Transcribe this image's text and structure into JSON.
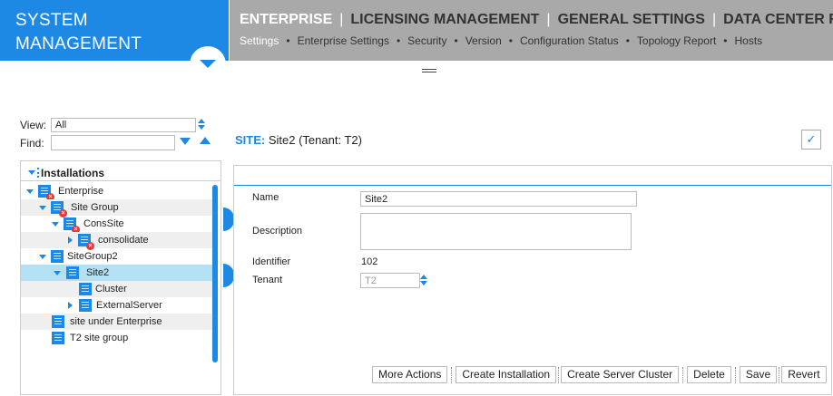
{
  "brand": {
    "line1": "SYSTEM",
    "line2": "MANAGEMENT"
  },
  "top_menu": [
    "ENTERPRISE",
    "LICENSING MANAGEMENT",
    "GENERAL SETTINGS",
    "DATA CENTER RE"
  ],
  "sub_menu": [
    "Settings",
    "Enterprise Settings",
    "Security",
    "Version",
    "Configuration Status",
    "Topology Report",
    "Hosts"
  ],
  "filter": {
    "view_label": "View:",
    "view_value": "All",
    "find_label": "Find:",
    "find_value": ""
  },
  "tree": {
    "header": "Installations",
    "items": [
      {
        "label": "Enterprise"
      },
      {
        "label": "Site Group"
      },
      {
        "label": "ConsSite"
      },
      {
        "label": "consolidate"
      },
      {
        "label": "SiteGroup2"
      },
      {
        "label": "Site2"
      },
      {
        "label": "Cluster"
      },
      {
        "label": "ExternalServer"
      },
      {
        "label": "site under Enterprise"
      },
      {
        "label": "T2 site group"
      }
    ]
  },
  "detail": {
    "kind": "SITE:",
    "title": "Site2 (Tenant: T2)",
    "check": "✓",
    "name_label": "Name",
    "name_value": "Site2",
    "description_label": "Description",
    "description_value": "",
    "identifier_label": "Identifier",
    "identifier_value": "102",
    "tenant_label": "Tenant",
    "tenant_value": "T2"
  },
  "buttons": [
    "More Actions",
    "Create Installation",
    "Create Server Cluster",
    "Delete",
    "Save",
    "Revert"
  ],
  "colors": {
    "accent": "#1e88e5",
    "header_gray": "#a9a9a9",
    "selected_row": "#b3e0f2",
    "error": "#e53935"
  }
}
